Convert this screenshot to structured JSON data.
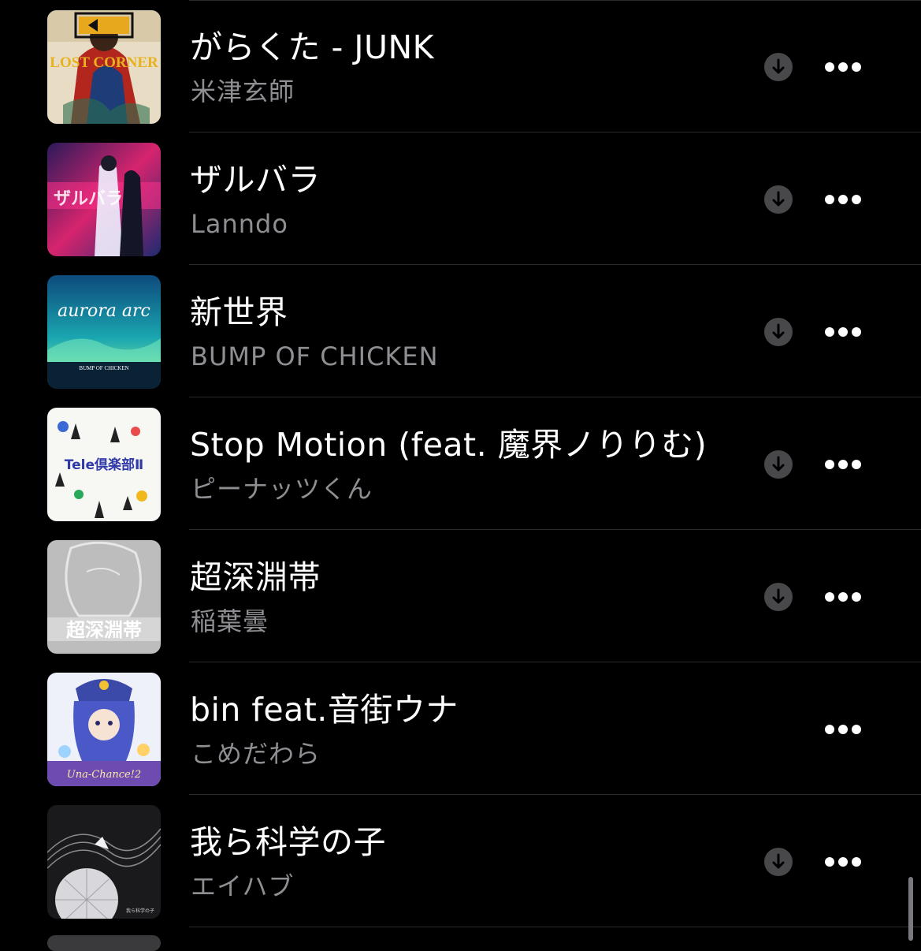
{
  "songs": [
    {
      "title": "がらくた - JUNK",
      "artist": "米津玄師",
      "artwork_text": "LOST CORNER",
      "downloaded_icon": "arrow-down-circle-icon",
      "more_icon": "ellipsis-icon"
    },
    {
      "title": "ザルバラ",
      "artist": "Lanndo",
      "artwork_text": "ザルバラ",
      "downloaded_icon": "arrow-down-circle-icon",
      "more_icon": "ellipsis-icon"
    },
    {
      "title": "新世界",
      "artist": "BUMP OF CHICKEN",
      "artwork_text": "aurora arc",
      "artwork_subtext": "BUMP OF CHICKEN",
      "downloaded_icon": "arrow-down-circle-icon",
      "more_icon": "ellipsis-icon"
    },
    {
      "title": "Stop Motion (feat. 魔界ノりりむ)",
      "artist": "ピーナッツくん",
      "artwork_text": "Tele倶楽部Ⅱ",
      "downloaded_icon": "arrow-down-circle-icon",
      "more_icon": "ellipsis-icon"
    },
    {
      "title": "超深淵帯",
      "artist": "稲葉曇",
      "artwork_text": "超深淵帯",
      "downloaded_icon": "arrow-down-circle-icon",
      "more_icon": "ellipsis-icon"
    },
    {
      "title": "bin feat.音街ウナ",
      "artist": "こめだわら",
      "artwork_text": "Una-Chance!2",
      "more_icon": "ellipsis-icon"
    },
    {
      "title": "我ら科学の子",
      "artist": "エイハブ",
      "artwork_text": "我ら科学の子",
      "downloaded_icon": "arrow-down-circle-icon",
      "more_icon": "ellipsis-icon"
    }
  ],
  "colors": {
    "background": "#000000",
    "title": "#ffffff",
    "artist": "#8e8e93",
    "divider": "#2c2c2e",
    "download_badge": "#48484a"
  }
}
